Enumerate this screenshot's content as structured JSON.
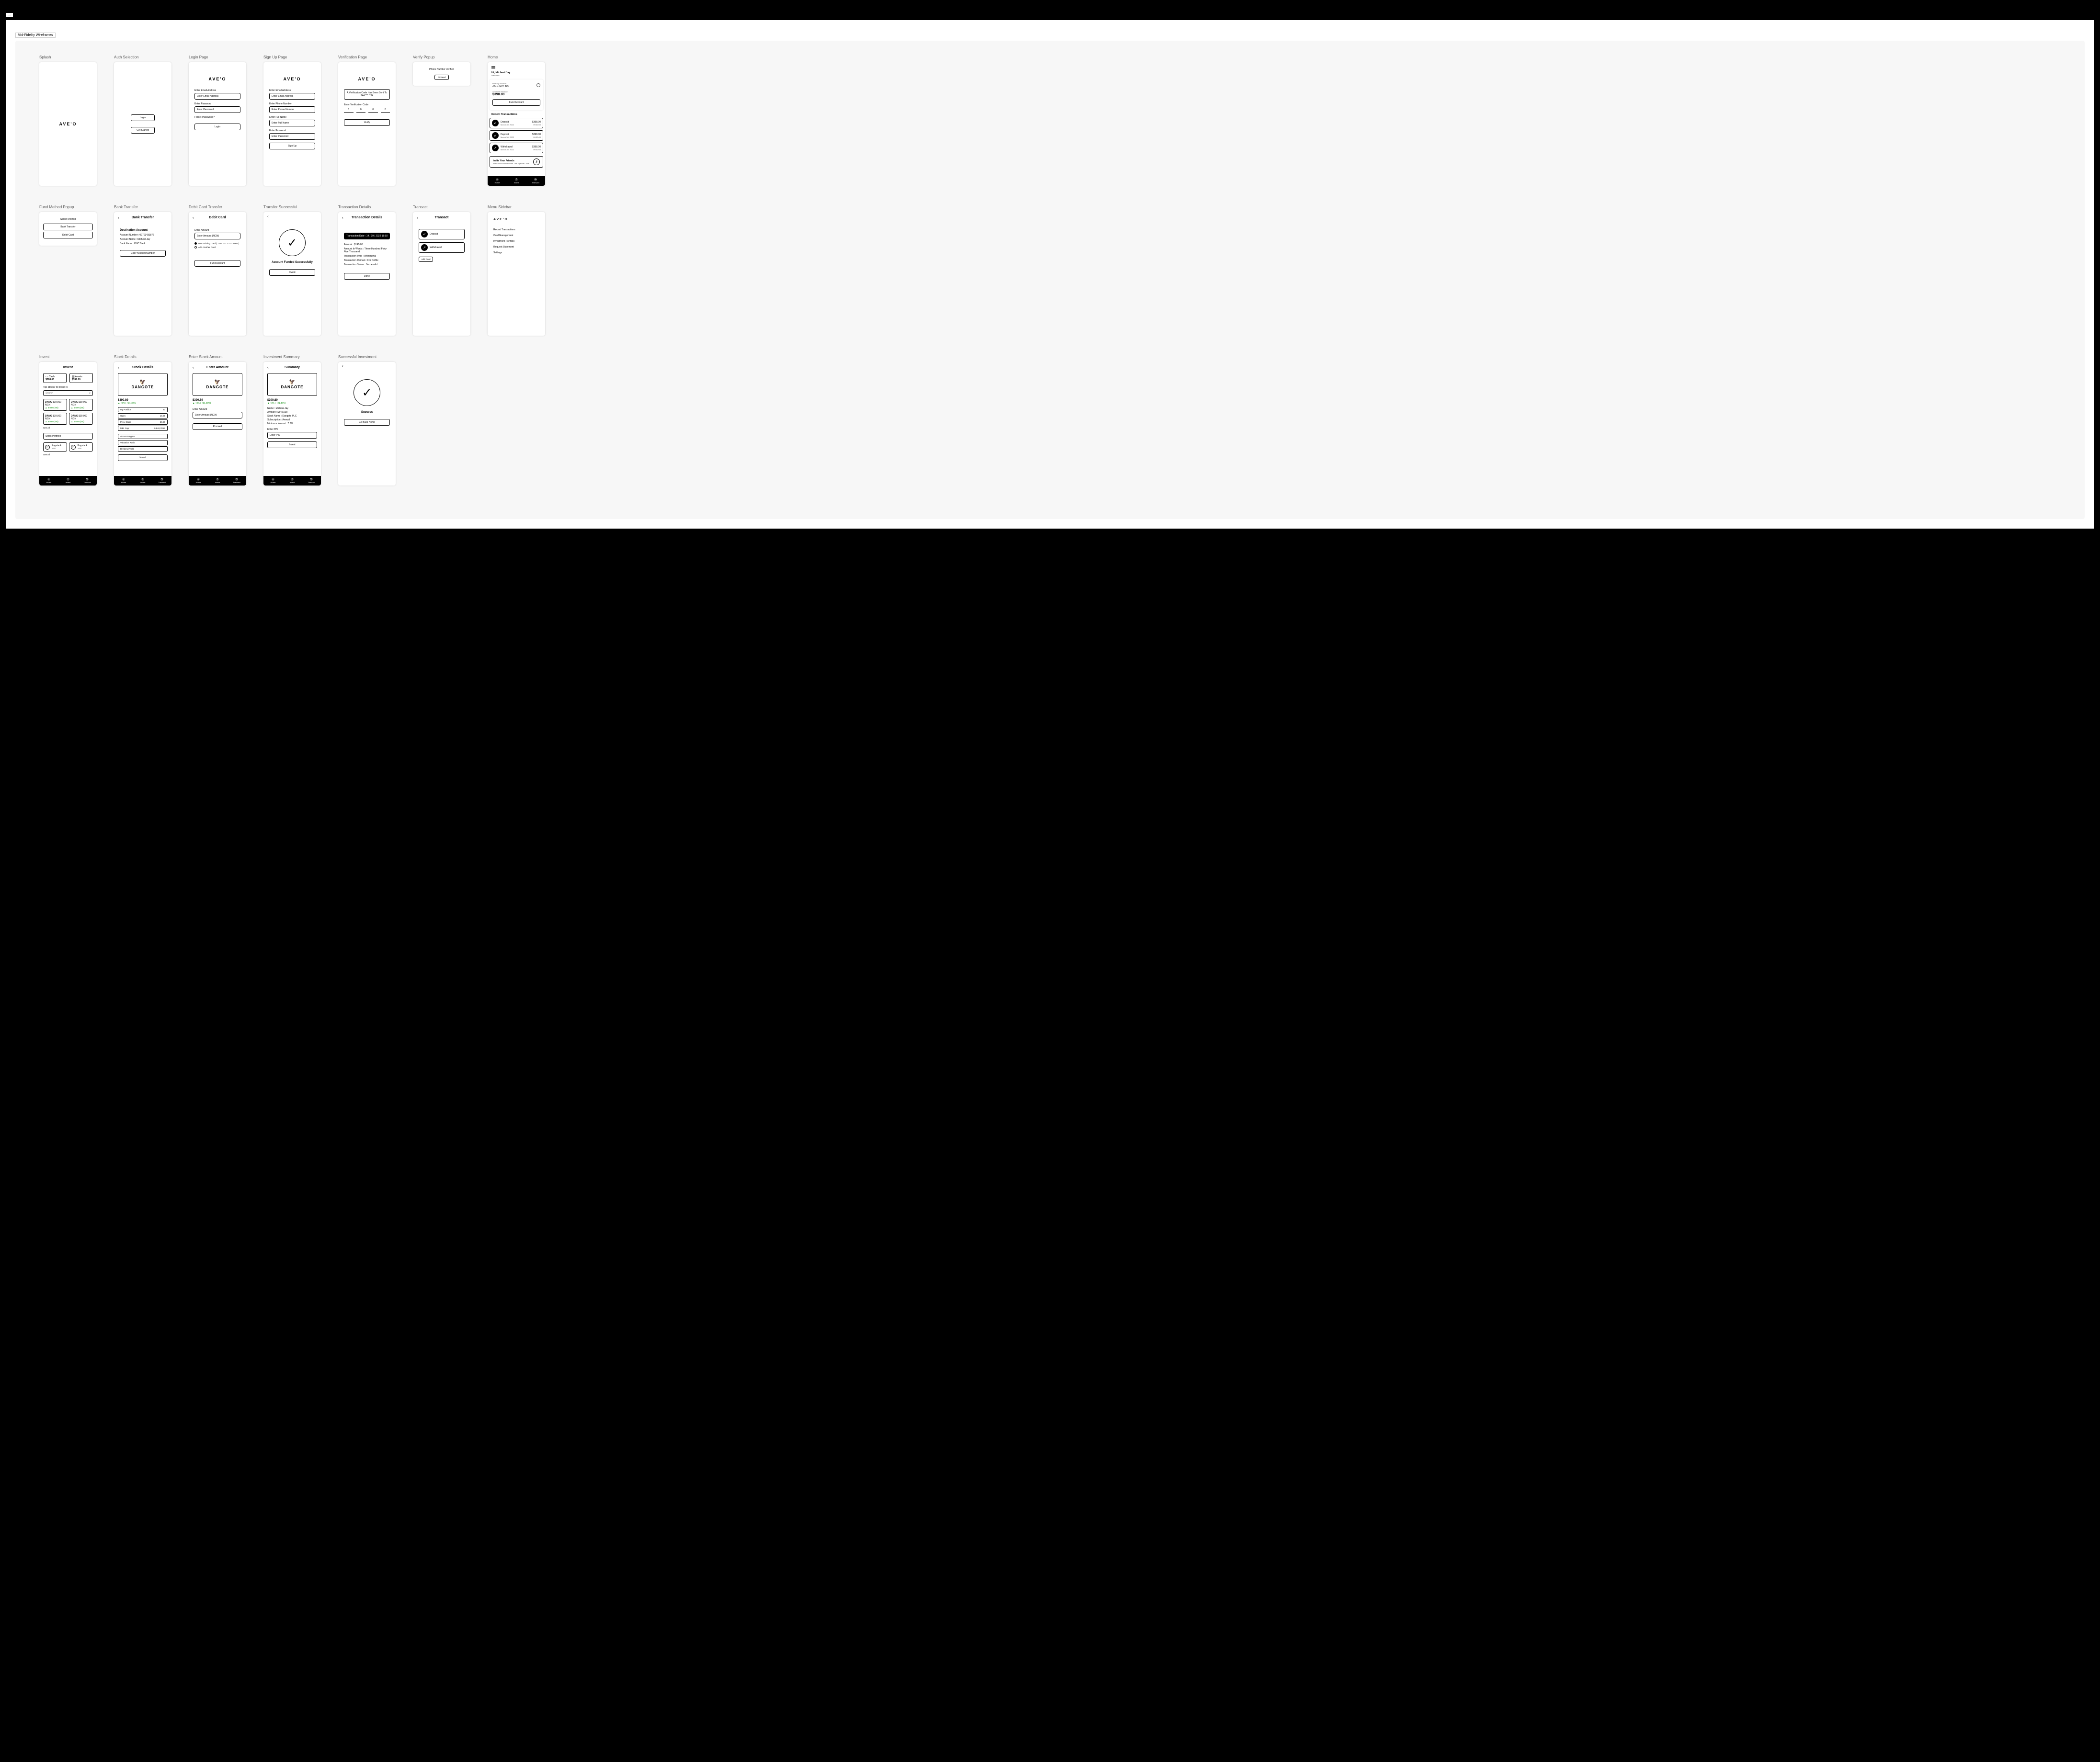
{
  "window_tab": "—",
  "canvas_tab": "Mid-Fidelity Wireframes",
  "brand": "AVE'O",
  "dangote": "DANGOTE",
  "nav": {
    "home": "Home",
    "invest": "Invest",
    "transact": "Transact"
  },
  "frames": {
    "splash": {
      "title": "Splash"
    },
    "auth": {
      "title": "Auth Selection",
      "login": "Login",
      "get_started": "Get Started"
    },
    "login": {
      "title": "Login Page",
      "email_lbl": "Enter Email Address",
      "email_ph": "Enter Email Address",
      "pw_lbl": "Enter Password",
      "pw_ph": "Enter Password",
      "forgot": "Forget Password ?",
      "btn": "Login"
    },
    "signup": {
      "title": "Sign Up Page",
      "email_lbl": "Enter Email Address",
      "email_ph": "Enter Email Address",
      "phone_lbl": "Enter Phone Number",
      "phone_ph": "Enter Phone Number",
      "name_lbl": "Enter Full Name",
      "name_ph": "Enter Full Name",
      "pw_lbl": "Enter Password",
      "pw_ph": "Enter Password",
      "btn": "Sign Up"
    },
    "verify": {
      "title": "Verification Page",
      "msg": "A Verification Code Has Been Sent To 244 *** **34",
      "code_lbl": "Enter Verification Code",
      "cell": "0",
      "btn": "Verify"
    },
    "verify_popup": {
      "title": "Verify Popup",
      "msg": "Phone Number Verified",
      "btn": "Proceed"
    },
    "home": {
      "title": "Home",
      "greet": "Hi, Micheal Jay",
      "welcome": "Welcome",
      "prim": "Primary Account",
      "acct": "3471-2294-816",
      "bal_lbl": "Available Balance",
      "bal": "$398.00",
      "fund": "Fund Account",
      "recent": "Recent Transactions",
      "tx": [
        {
          "t": "Deposit",
          "d": "March 30, 2022",
          "a": "$398.00",
          "s": "09:00:00"
        },
        {
          "t": "Deposit",
          "d": "March 30, 2022",
          "a": "$398.00",
          "s": "09:00:00"
        },
        {
          "t": "Withdrawal",
          "d": "March 30, 2022",
          "a": "$398.00",
          "s": "09:00:00"
        }
      ],
      "invite_t": "Invite Your Friends",
      "invite_s": "Invite Your Friends With This Special Code"
    },
    "fund_popup": {
      "title": "Fund Method Popup",
      "hdr": "Select Method",
      "bank": "Bank Transfer",
      "card": "Debit Card"
    },
    "bank": {
      "title": "Bank Transfer",
      "hdr": "Bank Transfer",
      "dest": "Destination Account",
      "acct": "Account Number : 09703431876",
      "name": "Account Name : Micheal Jay",
      "bname": "Bank Name : PHC Bank",
      "copy": "Copy Account Number"
    },
    "debit": {
      "title": "Debit Card Transfer",
      "hdr": "Debit Card",
      "amt_lbl": "Enter Amount",
      "amt_ph": "Enter Amount (NGN)",
      "opt1": "Use Existing Card ( 1234 **** ** **** 9964 )",
      "opt2": "Add Another Card",
      "btn": "Fund Account"
    },
    "transfer_ok": {
      "title": "Transfer Successful",
      "msg": "Account Funded Successfully",
      "btn": "Invest"
    },
    "tx_detail": {
      "title": "Transaction Details",
      "hdr": "Transaction Details",
      "date": "Transaction Date : 14 / 09 / 2022 16:02",
      "rows": [
        "Amount : $145.00",
        "Amount In Words : Three Hundred Forty Five Thousand",
        "Transaction Type : Withdrawal",
        "Transaction Remark : For Netflix",
        "Transaction Status : Successful"
      ],
      "btn": "Done"
    },
    "transact": {
      "title": "Transact",
      "hdr": "Transact",
      "dep": "Deposit",
      "wd": "Withdrawal",
      "add": "Add Card"
    },
    "menu": {
      "title": "Menu Sidebar",
      "items": [
        "Recent Transactions",
        "Card Management",
        "Investment Portfolio",
        "Request Statement",
        "Settings"
      ]
    },
    "invest": {
      "title": "Invest",
      "hdr": "Invest",
      "cash_lbl": "Cash",
      "cash": "$398.00",
      "assets_lbl": "Assets",
      "assets": "$398.00",
      "top": "Top Stocks To Invest In",
      "search": "Search",
      "stocks": [
        {
          "sym": "DANG",
          "p": "$39,000 NGN",
          "c": "▲ 6.02% (90)"
        },
        {
          "sym": "DANG",
          "p": "$39,000 NGN",
          "c": "▲ 6.02% (90)"
        },
        {
          "sym": "DANG",
          "p": "$39,000 NGN",
          "c": "▲ 6.02% (90)"
        },
        {
          "sym": "DANG",
          "p": "$39,000 NGN",
          "c": "▲ 6.02% (90)"
        }
      ],
      "see_all": "See All",
      "portfolio": "Stock Portfolio",
      "pay": "Paystack",
      "pay_c": "+5%"
    },
    "stock": {
      "title": "Stock Details",
      "hdr": "Stock Details",
      "price": "$390.89",
      "chg": "▲ +3% ( +21.48%)",
      "rows": [
        {
          "k": "My Position",
          "v": "30"
        },
        {
          "k": "Open",
          "v": "18.06"
        },
        {
          "k": "Prev. Close",
          "v": "20.20"
        },
        {
          "k": "Mkt. Cap",
          "v": "9,940,789B"
        }
      ],
      "about": "About Dangote",
      "val": "Valuation Ratio",
      "div": "Dividend Yield",
      "btn": "Invest"
    },
    "enter_amt": {
      "title": "Enter Stock Amount",
      "hdr": "Enter Amount",
      "price": "$390.89",
      "chg": "▲ +3% ( +21.48%)",
      "lbl": "Enter Amount",
      "ph": "Enter Amount (NGN)",
      "btn": "Proceed"
    },
    "summary": {
      "title": "Investment Summary",
      "hdr": "Summary",
      "price": "$390.89",
      "chg": "▲ +3% ( +21.48%)",
      "rows": [
        "Name : Micheal Jay",
        "Amount : $345.000",
        "Stock Name : Dangote PLC",
        "Subscription : Annual",
        "Minimum Interest : 7.2%"
      ],
      "pin_lbl": "Enter PIN",
      "pin_ph": "Enter PIN",
      "btn": "Invest"
    },
    "invest_ok": {
      "title": "Successful Investment",
      "msg": "Success",
      "btn": "Go Back Home"
    }
  }
}
